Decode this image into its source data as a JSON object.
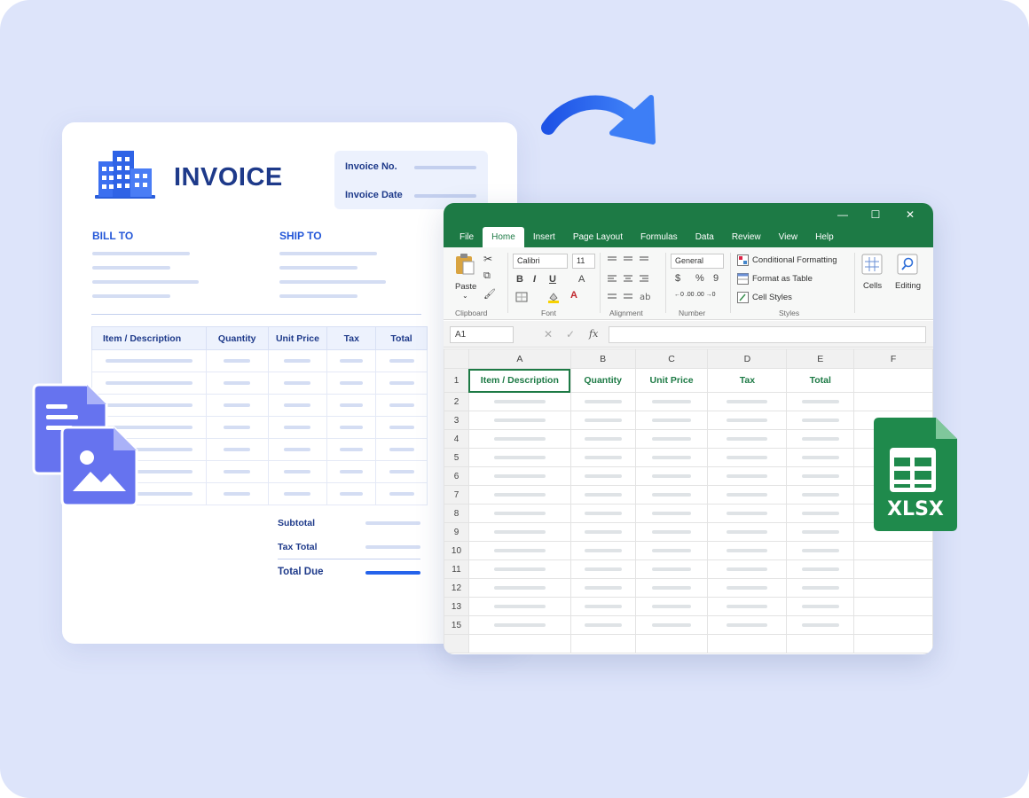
{
  "invoice": {
    "title": "INVOICE",
    "meta": {
      "invoice_no_label": "Invoice No.",
      "invoice_date_label": "Invoice Date"
    },
    "bill_to": "BILL TO",
    "ship_to": "SHIP TO",
    "table_headers": [
      "Item / Description",
      "Quantity",
      "Unit Price",
      "Tax",
      "Total"
    ],
    "totals": {
      "subtotal": "Subtotal",
      "tax_total": "Tax Total",
      "total_due": "Total Due"
    }
  },
  "excel": {
    "tabs": [
      "File",
      "Home",
      "Insert",
      "Page Layout",
      "Formulas",
      "Data",
      "Review",
      "View",
      "Help"
    ],
    "active_tab": "Home",
    "ribbon": {
      "paste": "Paste",
      "font_name": "Calibri",
      "font_size": "11",
      "number_format": "General",
      "conditional_formatting": "Conditional Formatting",
      "format_as_table": "Format as Table",
      "cell_styles": "Cell Styles",
      "cells": "Cells",
      "editing": "Editing",
      "groups": {
        "clipboard": "Clipboard",
        "font": "Font",
        "alignment": "Alignment",
        "number": "Number",
        "styles": "Styles"
      },
      "bold": "B",
      "italic": "I",
      "underline": "U",
      "currency": "$",
      "percent": "%",
      "comma": "9",
      "dec_inc": "←0 .00",
      "dec_dec": ".00 →0"
    },
    "name_box": "A1",
    "fx": "fx",
    "columns": [
      "A",
      "B",
      "C",
      "D",
      "E",
      "F"
    ],
    "rows": [
      "1",
      "2",
      "3",
      "4",
      "5",
      "6",
      "7",
      "8",
      "9",
      "10",
      "11",
      "12",
      "13",
      "15"
    ],
    "header_row": [
      "Item / Description",
      "Quantity",
      "Unit Price",
      "Tax",
      "Total"
    ],
    "window_controls": {
      "minimize": "—",
      "maximize": "☐",
      "close": "✕"
    }
  },
  "badge": {
    "label": "XLSX"
  },
  "colors": {
    "excel_green": "#1d7a45",
    "invoice_blue": "#1e3a8a",
    "accent_blue": "#2457d8",
    "background": "#dde4fa"
  }
}
